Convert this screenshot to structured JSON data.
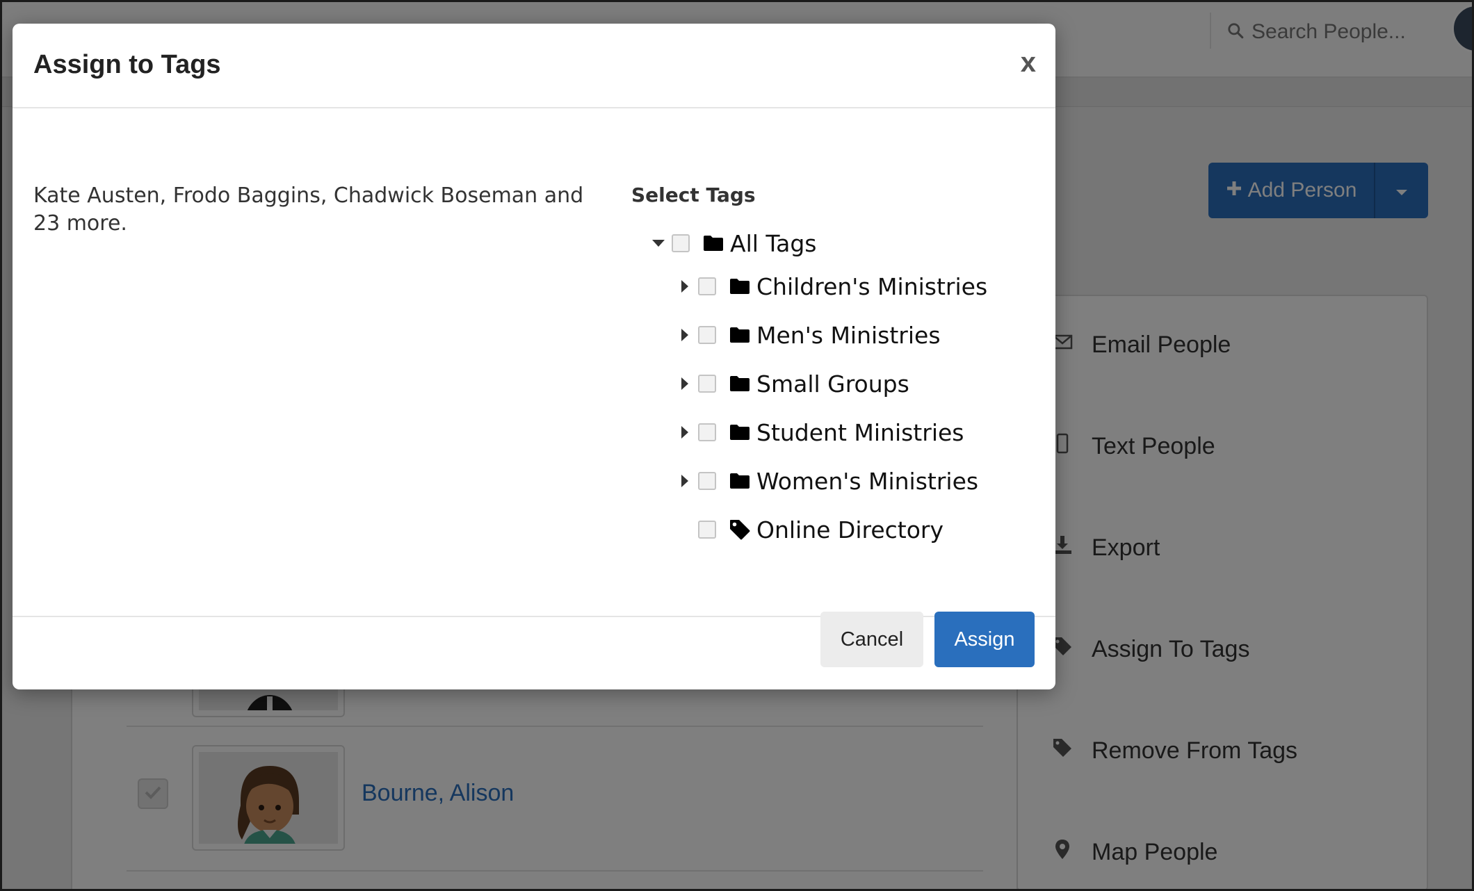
{
  "background": {
    "search_placeholder": "Search People...",
    "add_person_label": "Add Person",
    "person_name": "Bourne, Alison",
    "actions": [
      {
        "label": "Email People",
        "icon": "envelope-icon"
      },
      {
        "label": "Text People",
        "icon": "phone-icon"
      },
      {
        "label": "Export",
        "icon": "download-icon"
      },
      {
        "label": "Assign To Tags",
        "icon": "tag-icon"
      },
      {
        "label": "Remove From Tags",
        "icon": "tag-icon"
      },
      {
        "label": "Map People",
        "icon": "map-pin-icon"
      }
    ]
  },
  "modal": {
    "title": "Assign to Tags",
    "close_label": "x",
    "recipients_text": "Kate Austen, Frodo Baggins, Chadwick Boseman and 23 more.",
    "select_tags_label": "Select Tags",
    "tree": {
      "root": {
        "label": "All Tags",
        "icon": "folder-icon",
        "expanded": true,
        "checked": false
      },
      "children": [
        {
          "label": "Children's Ministries",
          "icon": "folder-icon",
          "expandable": true,
          "checked": false
        },
        {
          "label": "Men's Ministries",
          "icon": "folder-icon",
          "expandable": true,
          "checked": false
        },
        {
          "label": "Small Groups",
          "icon": "folder-icon",
          "expandable": true,
          "checked": false
        },
        {
          "label": "Student Ministries",
          "icon": "folder-icon",
          "expandable": true,
          "checked": false
        },
        {
          "label": "Women's Ministries",
          "icon": "folder-icon",
          "expandable": true,
          "checked": false
        },
        {
          "label": "Online Directory",
          "icon": "tag-icon",
          "expandable": false,
          "checked": false
        }
      ]
    },
    "cancel_label": "Cancel",
    "assign_label": "Assign"
  },
  "colors": {
    "primary": "#2a6fbd",
    "link": "#2a6fbd",
    "overlay": "rgba(0,0,0,0.5)"
  }
}
